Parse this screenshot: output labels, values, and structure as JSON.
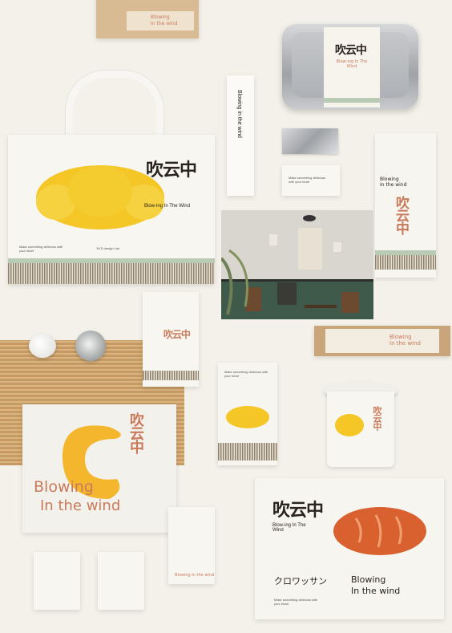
{
  "brand": {
    "name_cn": "吹云中",
    "tagline_short": "Blow-ing In The Wind",
    "tagline_long_1": "Blowing",
    "tagline_long_2": "In the wind",
    "croissant_jp": "クロワッサン",
    "footer_en": "Make something delicious with your heart",
    "footer_design": "YiLD design Lab"
  },
  "colors": {
    "background": "#f4f1ea",
    "croissant_yellow": "#f4c727",
    "bread_orange": "#d8612f",
    "accent_pink": "#c97a5b",
    "brand_dark": "#2b2320",
    "band_green": "#b9cbb5",
    "kraft": "#c9a57c",
    "bamboo": "#c79a63"
  },
  "photo": {
    "scene": "cafe interior with chairs, plant and macrame"
  }
}
